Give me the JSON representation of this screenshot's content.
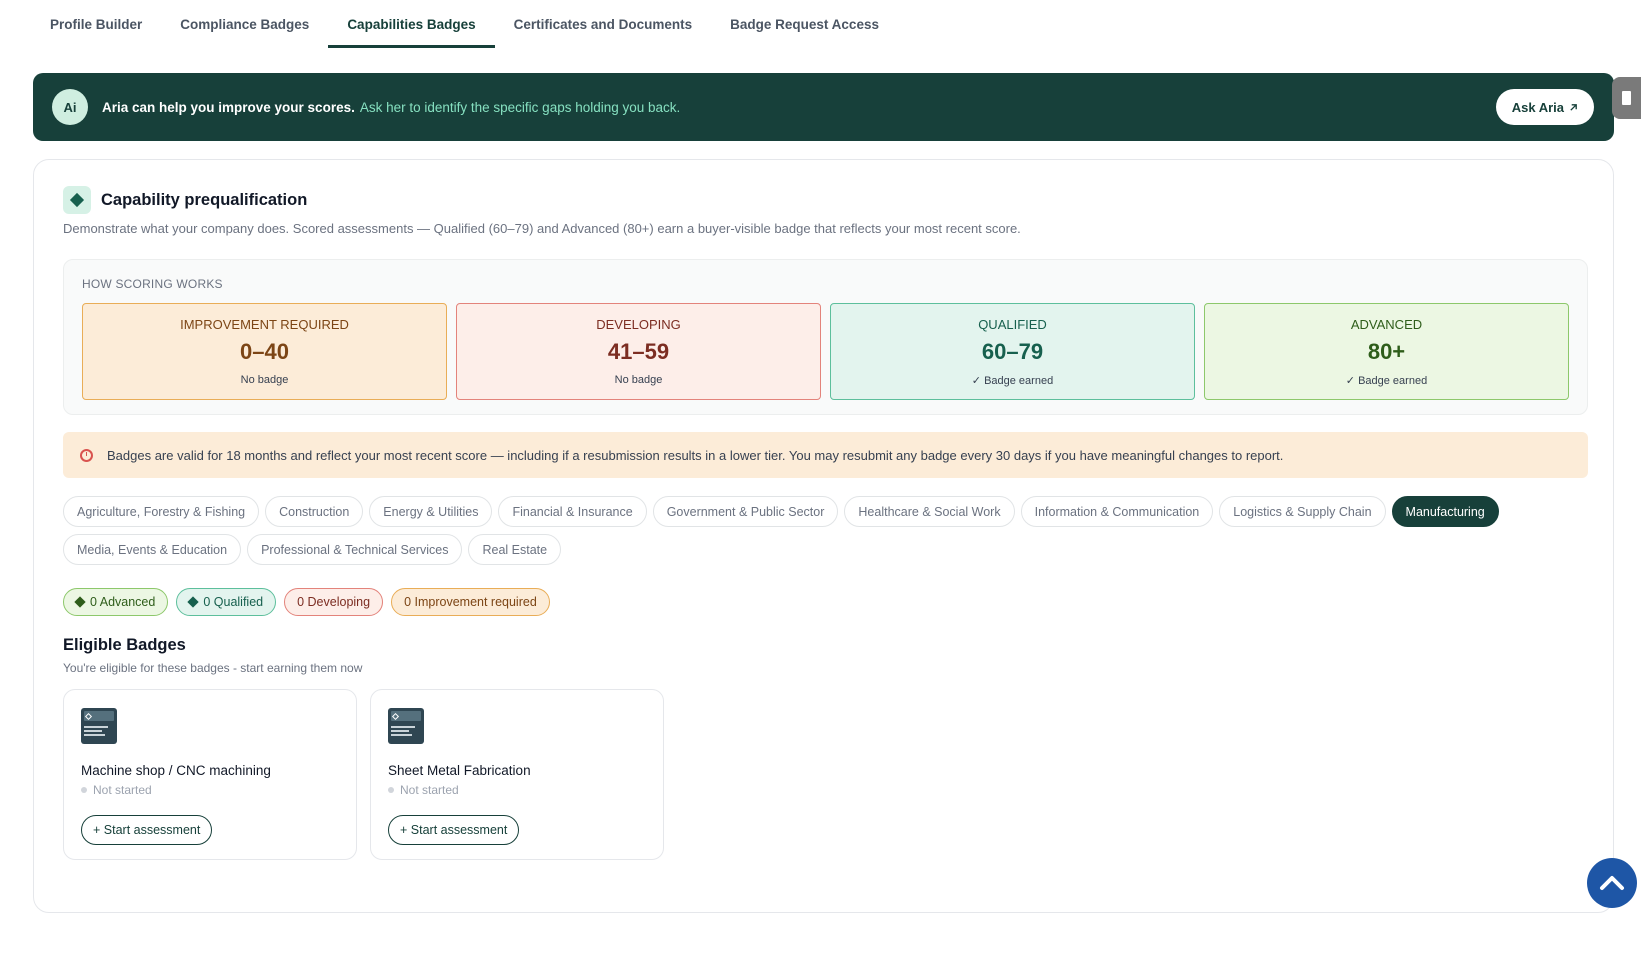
{
  "tabs": [
    {
      "label": "Profile Builder",
      "active": false
    },
    {
      "label": "Compliance Badges",
      "active": false
    },
    {
      "label": "Capabilities Badges",
      "active": true
    },
    {
      "label": "Certificates and Documents",
      "active": false
    },
    {
      "label": "Badge Request Access",
      "active": false
    }
  ],
  "aria_banner": {
    "avatar": "Ai",
    "text": "Aria can help you improve your scores.",
    "link": "Ask her to identify the specific gaps holding you back.",
    "button_label": "Ask Aria",
    "button_icon": "external-arrow-icon"
  },
  "section": {
    "icon": "diamond-icon",
    "title": "Capability prequalification",
    "description": "Demonstrate what your company does. Scored assessments — Qualified (60–79) and Advanced (80+) earn a buyer-visible badge that reflects your most recent score."
  },
  "scoring": {
    "label": "HOW SCORING WORKS",
    "tiers": [
      {
        "name": "IMPROVEMENT REQUIRED",
        "range": "0–40",
        "note": "No badge"
      },
      {
        "name": "DEVELOPING",
        "range": "41–59",
        "note": "No badge"
      },
      {
        "name": "QUALIFIED",
        "range": "60–79",
        "note": "✓ Badge earned"
      },
      {
        "name": "ADVANCED",
        "range": "80+",
        "note": "✓ Badge earned"
      }
    ]
  },
  "notice": {
    "icon": "alarm-clock-icon",
    "text": "Badges are valid for 18 months and reflect your most recent score — including if a resubmission results in a lower tier. You may resubmit any badge every 30 days if you have meaningful changes to report."
  },
  "industries": [
    {
      "label": "Agriculture, Forestry & Fishing",
      "active": false
    },
    {
      "label": "Construction",
      "active": false
    },
    {
      "label": "Energy & Utilities",
      "active": false
    },
    {
      "label": "Financial & Insurance",
      "active": false
    },
    {
      "label": "Government & Public Sector",
      "active": false
    },
    {
      "label": "Healthcare & Social Work",
      "active": false
    },
    {
      "label": "Information & Communication",
      "active": false
    },
    {
      "label": "Logistics & Supply Chain",
      "active": false
    },
    {
      "label": "Manufacturing",
      "active": true
    },
    {
      "label": "Media, Events & Education",
      "active": false
    },
    {
      "label": "Professional & Technical Services",
      "active": false
    },
    {
      "label": "Real Estate",
      "active": false
    }
  ],
  "counts": {
    "advanced": "0 Advanced",
    "qualified": "0 Qualified",
    "developing": "0 Developing",
    "improvement": "0 Improvement required"
  },
  "eligible": {
    "title": "Eligible Badges",
    "subtitle": "You're eligible for these badges - start earning them now",
    "badges": [
      {
        "name": "Machine shop / CNC machining",
        "status": "Not started",
        "button": "+ Start assessment"
      },
      {
        "name": "Sheet Metal Fabrication",
        "status": "Not started",
        "button": "+ Start assessment"
      }
    ]
  },
  "colors": {
    "brand_dark": "#17403a",
    "scroll_button": "#1e56a6",
    "aria_link": "#86e0c0"
  }
}
